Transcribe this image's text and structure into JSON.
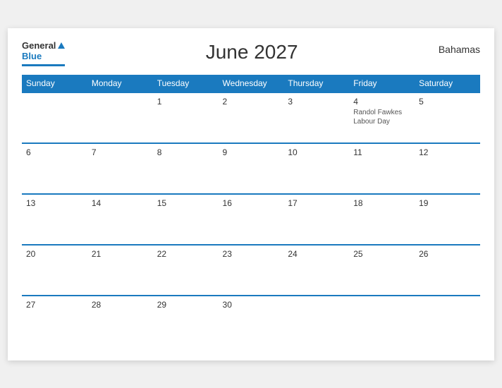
{
  "logo": {
    "general": "General",
    "blue": "Blue",
    "triangle": "▲"
  },
  "title": "June 2027",
  "country": "Bahamas",
  "weekdays": [
    "Sunday",
    "Monday",
    "Tuesday",
    "Wednesday",
    "Thursday",
    "Friday",
    "Saturday"
  ],
  "weeks": [
    [
      {
        "day": "",
        "holiday": ""
      },
      {
        "day": "",
        "holiday": ""
      },
      {
        "day": "1",
        "holiday": ""
      },
      {
        "day": "2",
        "holiday": ""
      },
      {
        "day": "3",
        "holiday": ""
      },
      {
        "day": "4",
        "holiday": "Randol Fawkes\nLabour Day"
      },
      {
        "day": "5",
        "holiday": ""
      }
    ],
    [
      {
        "day": "6",
        "holiday": ""
      },
      {
        "day": "7",
        "holiday": ""
      },
      {
        "day": "8",
        "holiday": ""
      },
      {
        "day": "9",
        "holiday": ""
      },
      {
        "day": "10",
        "holiday": ""
      },
      {
        "day": "11",
        "holiday": ""
      },
      {
        "day": "12",
        "holiday": ""
      }
    ],
    [
      {
        "day": "13",
        "holiday": ""
      },
      {
        "day": "14",
        "holiday": ""
      },
      {
        "day": "15",
        "holiday": ""
      },
      {
        "day": "16",
        "holiday": ""
      },
      {
        "day": "17",
        "holiday": ""
      },
      {
        "day": "18",
        "holiday": ""
      },
      {
        "day": "19",
        "holiday": ""
      }
    ],
    [
      {
        "day": "20",
        "holiday": ""
      },
      {
        "day": "21",
        "holiday": ""
      },
      {
        "day": "22",
        "holiday": ""
      },
      {
        "day": "23",
        "holiday": ""
      },
      {
        "day": "24",
        "holiday": ""
      },
      {
        "day": "25",
        "holiday": ""
      },
      {
        "day": "26",
        "holiday": ""
      }
    ],
    [
      {
        "day": "27",
        "holiday": ""
      },
      {
        "day": "28",
        "holiday": ""
      },
      {
        "day": "29",
        "holiday": ""
      },
      {
        "day": "30",
        "holiday": ""
      },
      {
        "day": "",
        "holiday": ""
      },
      {
        "day": "",
        "holiday": ""
      },
      {
        "day": "",
        "holiday": ""
      }
    ]
  ]
}
